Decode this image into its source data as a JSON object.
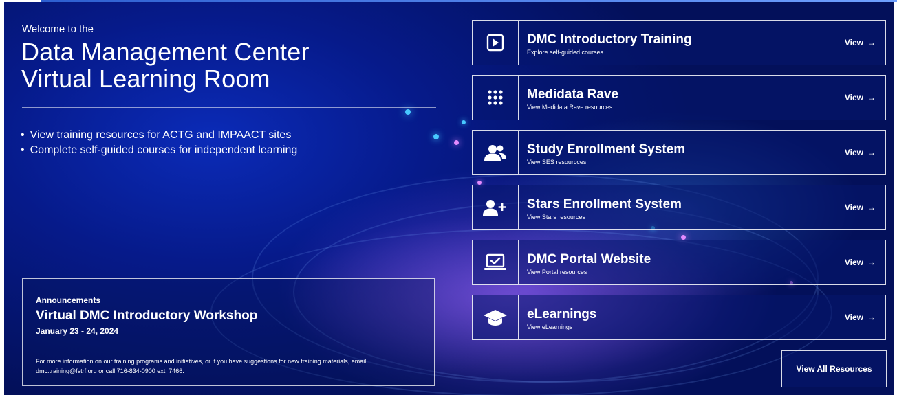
{
  "hero": {
    "welcome": "Welcome to the",
    "title_line1": "Data Management Center",
    "title_line2": "Virtual Learning Room",
    "bullets": [
      "View training resources for ACTG and IMPAACT sites",
      "Complete self-guided courses for independent learning"
    ]
  },
  "announcements": {
    "label": "Announcements",
    "title": "Virtual DMC Introductory Workshop",
    "date": "January 23 - 24, 2024",
    "info_text": "For more information on our training programs and initiatives, or if you have suggestions for new training materials, email",
    "email": "dmc.training@fstrf.org",
    "info_suffix": "or call 716-834-0900 ext. 7466."
  },
  "resources": [
    {
      "title": "DMC Introductory Training",
      "subtitle": "Explore self-guided courses",
      "icon": "play-icon",
      "view": "View"
    },
    {
      "title": "Medidata Rave",
      "subtitle": "View Medidata Rave resources",
      "icon": "grid-dots-icon",
      "view": "View"
    },
    {
      "title": "Study Enrollment System",
      "subtitle": "View SES resourcces",
      "icon": "users-icon",
      "view": "View"
    },
    {
      "title": "Stars Enrollment System",
      "subtitle": "View Stars resources",
      "icon": "user-plus-icon",
      "view": "View"
    },
    {
      "title": "DMC Portal Website",
      "subtitle": "View Portal resources",
      "icon": "laptop-check-icon",
      "view": "View"
    },
    {
      "title": "eLearnings",
      "subtitle": "View eLearnings",
      "icon": "graduation-cap-icon",
      "view": "View"
    }
  ],
  "view_all": "View All Resources",
  "colors": {
    "background_deep": "#03105a",
    "background_mid": "#0b2bb8",
    "accent_pink": "#e48bff",
    "accent_cyan": "#47c8ff",
    "text": "#ffffff"
  }
}
